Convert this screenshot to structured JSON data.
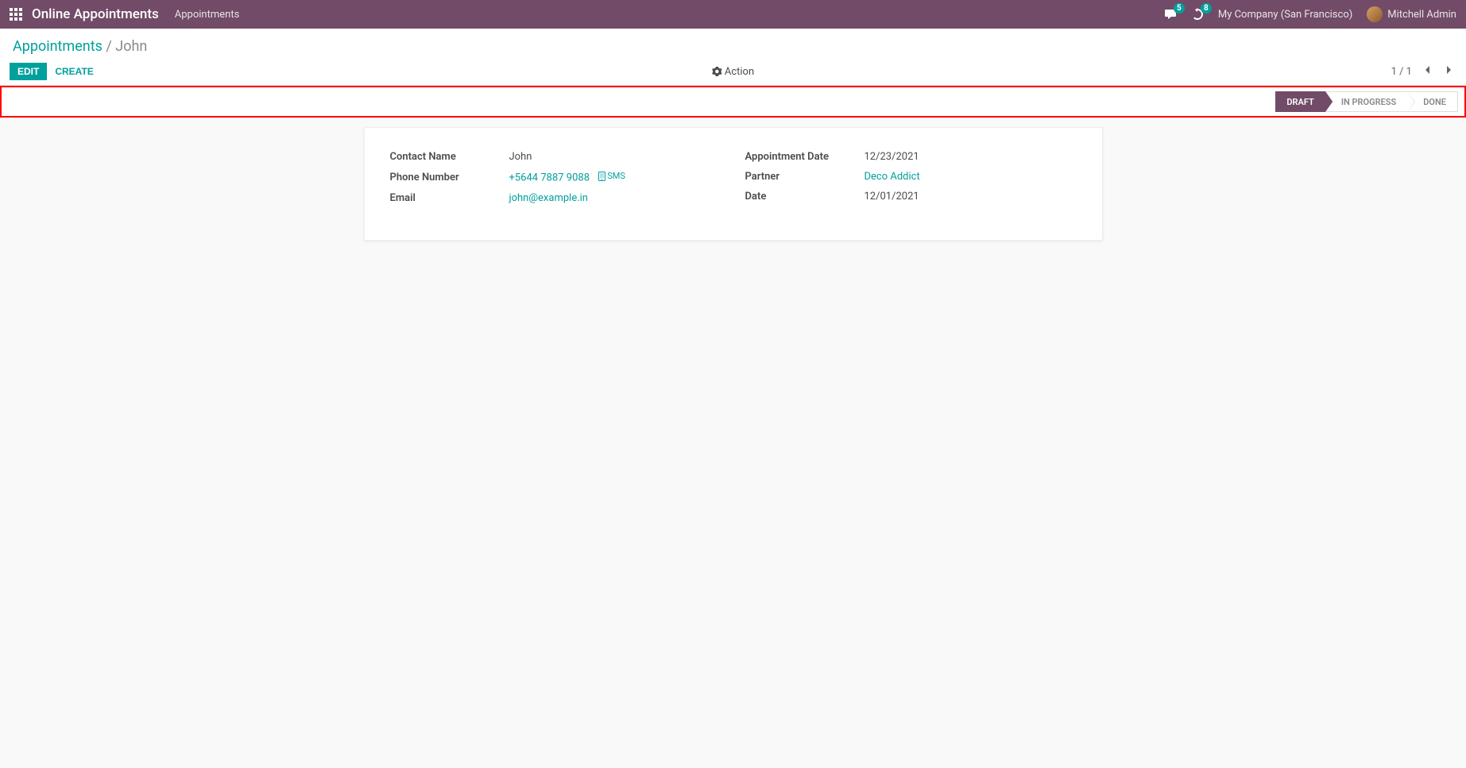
{
  "nav": {
    "brand": "Online Appointments",
    "menu_item": "Appointments",
    "chat_badge": "5",
    "activity_badge": "8",
    "company": "My Company (San Francisco)",
    "user": "Mitchell Admin"
  },
  "breadcrumb": {
    "root": "Appointments",
    "current": "John"
  },
  "buttons": {
    "edit": "Edit",
    "create": "Create",
    "action": "Action"
  },
  "pager": {
    "text": "1 / 1"
  },
  "status": {
    "draft": "Draft",
    "in_progress": "In Progress",
    "done": "Done"
  },
  "fields": {
    "contact_name_label": "Contact Name",
    "contact_name": "John",
    "phone_label": "Phone Number",
    "phone": "+5644 7887 9088",
    "sms": "SMS",
    "email_label": "Email",
    "email": "john@example.in",
    "appt_date_label": "Appointment Date",
    "appt_date": "12/23/2021",
    "partner_label": "Partner",
    "partner": "Deco Addict",
    "date_label": "Date",
    "date": "12/01/2021"
  }
}
